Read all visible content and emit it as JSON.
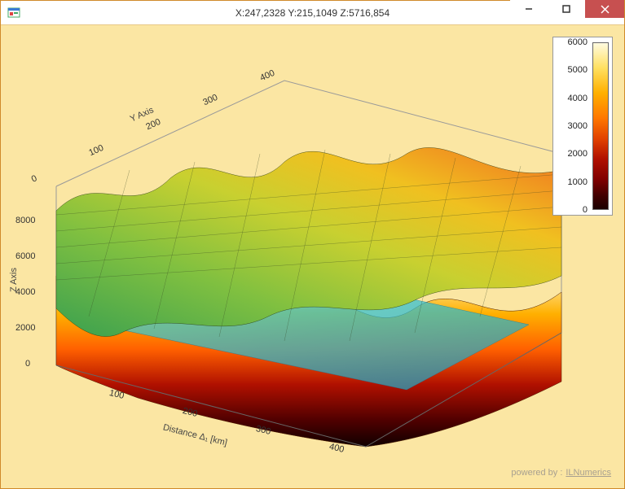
{
  "window": {
    "title": "X:247,2328 Y:215,1049 Z:5716,854",
    "controls": {
      "minimize": "minimize",
      "maximize": "maximize",
      "close": "close"
    }
  },
  "footer": {
    "prefix": "powered by :",
    "link": "ILNumerics"
  },
  "chart_data": {
    "type": "surface3d",
    "description": "Two stacked 3D terrain surfaces over a 0–400 × 0–400 grid. Upper surface colored by its own height (green→yellow→orange, roughly 4000–8000). Lower surface colored by a separate colormap shown in the colorbar (dark→red→orange→yellow, 0–6000). A translucent cyan water plane intersects between them near z≈3000.",
    "surfaces": [
      {
        "name": "upper-terrain",
        "z_range_estimate": [
          4000,
          9000
        ],
        "wireframe": true,
        "colormap": "green-yellow-orange by height"
      },
      {
        "name": "lower-terrain",
        "z_range_estimate": [
          0,
          6000
        ],
        "wireframe": false,
        "colormap": "colorbar (black-red-orange-yellow-white)"
      },
      {
        "name": "water-plane",
        "z_constant_estimate": 3000,
        "color": "cyan translucent"
      }
    ],
    "axes": {
      "x": {
        "label": "Distance Δ₁ [km]",
        "ticks": [
          100,
          200,
          300,
          400
        ],
        "range": [
          0,
          420
        ]
      },
      "y": {
        "label": "Y Axis",
        "ticks": [
          0,
          100,
          200,
          300,
          400
        ],
        "range": [
          0,
          420
        ]
      },
      "z": {
        "label": "Z Axis",
        "ticks": [
          0,
          2000,
          4000,
          6000,
          8000
        ],
        "range": [
          0,
          9000
        ]
      }
    },
    "colorbar": {
      "range": [
        0,
        6000
      ],
      "ticks": [
        0,
        1000,
        2000,
        3000,
        4000,
        5000,
        6000
      ],
      "colormap": "hot (black → dark-red → red → orange → yellow → near-white)"
    },
    "cursor_readout": {
      "X": 247.2328,
      "Y": 215.1049,
      "Z": 5716.854
    }
  },
  "labels": {
    "x_axis": "Distance Δ₁ [km]",
    "y_axis": "Y Axis",
    "z_axis": "Z Axis"
  },
  "ticks": {
    "x": [
      "100",
      "200",
      "300",
      "400"
    ],
    "y": [
      "0",
      "100",
      "200",
      "300",
      "400"
    ],
    "z": [
      "0",
      "2000",
      "4000",
      "6000",
      "8000"
    ],
    "cb": [
      "0",
      "1000",
      "2000",
      "3000",
      "4000",
      "5000",
      "6000"
    ]
  }
}
